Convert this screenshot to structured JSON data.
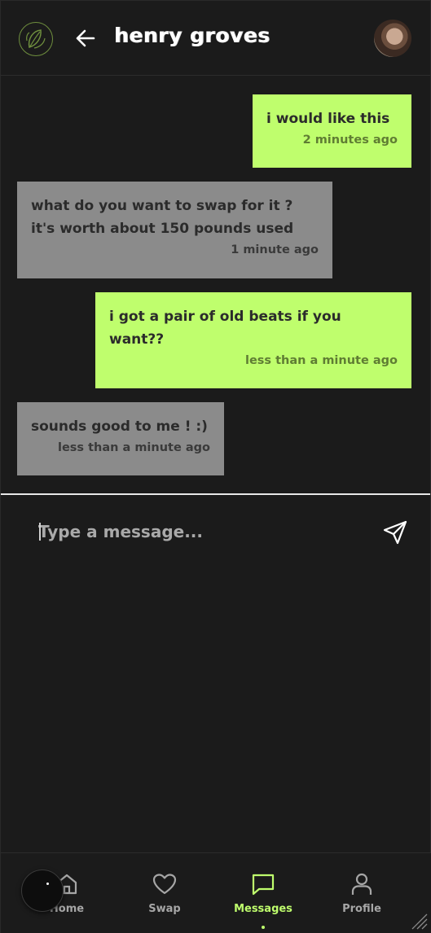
{
  "header": {
    "title": "henry groves",
    "logo_icon": "leaf-logo-icon",
    "back_icon": "arrow-left-icon",
    "avatar_icon": "user-avatar"
  },
  "messages": [
    {
      "sender": "me",
      "text": "i would like this",
      "time": "2 minutes ago"
    },
    {
      "sender": "them",
      "text": "what do you want to swap for it ? it's worth about 150 pounds used",
      "time": "1 minute ago"
    },
    {
      "sender": "me",
      "text": "i got a pair of old beats if you want??",
      "time": "less than a minute ago"
    },
    {
      "sender": "them",
      "text": "sounds good to me ! :)",
      "time": "less than a minute ago"
    }
  ],
  "composer": {
    "placeholder": "Type a message...",
    "value": "",
    "send_icon": "send-icon"
  },
  "nav": {
    "items": [
      {
        "label": "Home",
        "icon": "home-icon",
        "active": false
      },
      {
        "label": "Swap",
        "icon": "heart-icon",
        "active": false
      },
      {
        "label": "Messages",
        "icon": "chat-icon",
        "active": true
      },
      {
        "label": "Profile",
        "icon": "user-icon",
        "active": false
      }
    ]
  },
  "colors": {
    "background": "#1b1b1b",
    "accent": "#bffe6d",
    "their_bubble": "#8b8b8b",
    "text_light": "#ffffff"
  }
}
